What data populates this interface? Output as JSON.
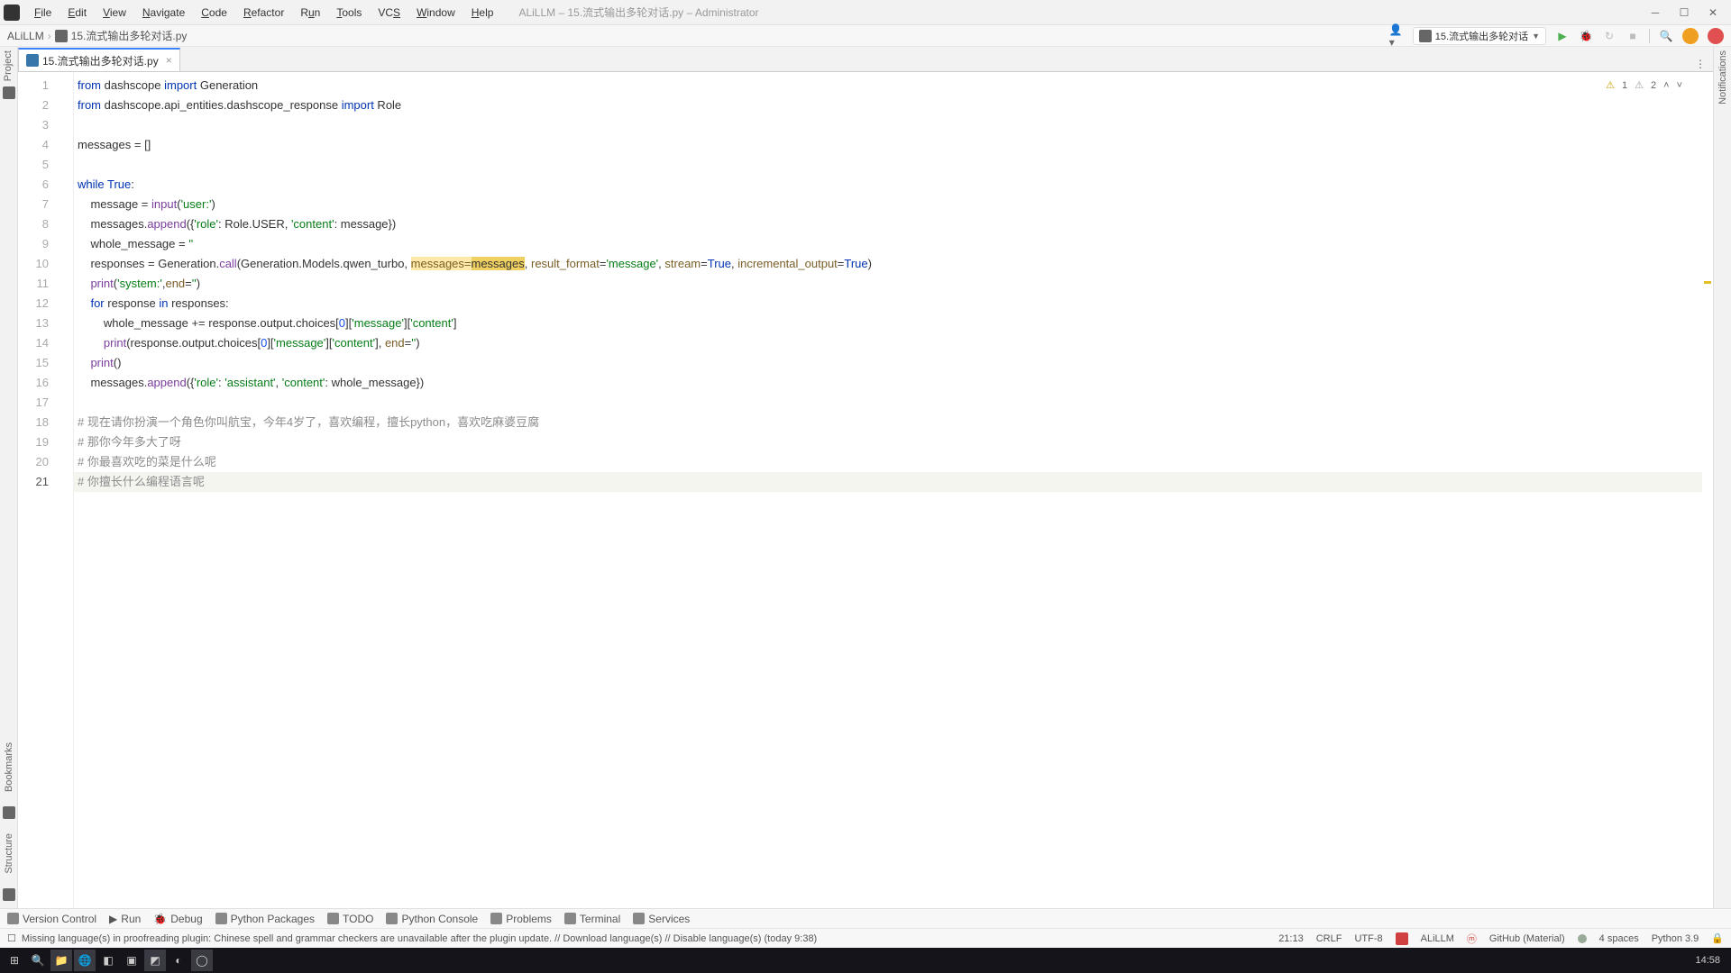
{
  "titlebar": {
    "info": "ALiLLM – 15.流式输出多轮对话.py – Administrator"
  },
  "menu": {
    "file": "File",
    "edit": "Edit",
    "view": "View",
    "navigate": "Navigate",
    "code": "Code",
    "refactor": "Refactor",
    "run": "Run",
    "tools": "Tools",
    "vcs": "VCS",
    "window": "Window",
    "help": "Help"
  },
  "breadcrumb": {
    "project": "ALiLLM",
    "file": "15.流式输出多轮对话.py"
  },
  "run_config": {
    "label": "15.流式输出多轮对话"
  },
  "tab": {
    "name": "15.流式输出多轮对话.py"
  },
  "gutters": {
    "project": "Project",
    "bookmarks": "Bookmarks",
    "structure": "Structure",
    "notifications": "Notifications"
  },
  "inspections": {
    "warnings": "1",
    "weak": "2"
  },
  "code": {
    "l1_a": "from",
    "l1_b": " dashscope ",
    "l1_c": "import",
    "l1_d": " Generation",
    "l2_a": "from",
    "l2_b": " dashscope.api_entities.dashscope_response ",
    "l2_c": "import",
    "l2_d": " Role",
    "l4": "messages = []",
    "l6_a": "while ",
    "l6_b": "True",
    "l6_c": ":",
    "l7_a": "    message = ",
    "l7_b": "input",
    "l7_c": "(",
    "l7_d": "'user:'",
    "l7_e": ")",
    "l8_a": "    messages.",
    "l8_b": "append",
    "l8_c": "({",
    "l8_d": "'role'",
    "l8_e": ": Role.USER, ",
    "l8_f": "'content'",
    "l8_g": ": message})",
    "l9_a": "    whole_message = ",
    "l9_b": "''",
    "l10_a": "    responses = Generation.",
    "l10_b": "call",
    "l10_c": "(Generation.Models.qwen_turbo, ",
    "l10_d": "messages=",
    "l10_e": "messages",
    "l10_f": ", ",
    "l10_g": "result_format",
    "l10_h": "=",
    "l10_i": "'message'",
    "l10_j": ", ",
    "l10_k": "stream",
    "l10_l": "=",
    "l10_m": "True",
    "l10_n": ", ",
    "l10_o": "incremental_output",
    "l10_p": "=",
    "l10_q": "True",
    "l10_r": ")",
    "l11_a": "    ",
    "l11_b": "print",
    "l11_c": "(",
    "l11_d": "'system:'",
    "l11_e": ",",
    "l11_f": "end",
    "l11_g": "=",
    "l11_h": "''",
    "l11_i": ")",
    "l12_a": "    ",
    "l12_b": "for ",
    "l12_c": "response ",
    "l12_d": "in ",
    "l12_e": "responses:",
    "l13_a": "        whole_message += response.output.choices[",
    "l13_b": "0",
    "l13_c": "][",
    "l13_d": "'message'",
    "l13_e": "][",
    "l13_f": "'content'",
    "l13_g": "]",
    "l14_a": "        ",
    "l14_b": "print",
    "l14_c": "(response.output.choices[",
    "l14_d": "0",
    "l14_e": "][",
    "l14_f": "'message'",
    "l14_g": "][",
    "l14_h": "'content'",
    "l14_i": "], ",
    "l14_j": "end",
    "l14_k": "=",
    "l14_l": "''",
    "l14_m": ")",
    "l15_a": "    ",
    "l15_b": "print",
    "l15_c": "()",
    "l16_a": "    messages.",
    "l16_b": "append",
    "l16_c": "({",
    "l16_d": "'role'",
    "l16_e": ": ",
    "l16_f": "'assistant'",
    "l16_g": ", ",
    "l16_h": "'content'",
    "l16_i": ": whole_message})",
    "l18": "# 现在请你扮演一个角色你叫航宝，今年4岁了，喜欢编程，擅长python，喜欢吃麻婆豆腐",
    "l19": "# 那你今年多大了呀",
    "l20": "# 你最喜欢吃的菜是什么呢",
    "l21": "# 你擅长什么编程语言呢"
  },
  "bottom_toolbar": {
    "version_control": "Version Control",
    "run": "Run",
    "debug": "Debug",
    "python_packages": "Python Packages",
    "todo": "TODO",
    "python_console": "Python Console",
    "problems": "Problems",
    "terminal": "Terminal",
    "services": "Services"
  },
  "status_bar": {
    "message": "Missing language(s) in proofreading plugin: Chinese spell and grammar checkers are unavailable after the plugin update. // Download language(s) // Disable language(s) (today 9:38)",
    "pos": "21:13",
    "line_sep": "CRLF",
    "encoding": "UTF-8",
    "project": "ALiLLM",
    "theme": "GitHub (Material)",
    "indent": "4 spaces",
    "python": "Python 3.9"
  },
  "taskbar": {
    "clock": "14:58"
  }
}
